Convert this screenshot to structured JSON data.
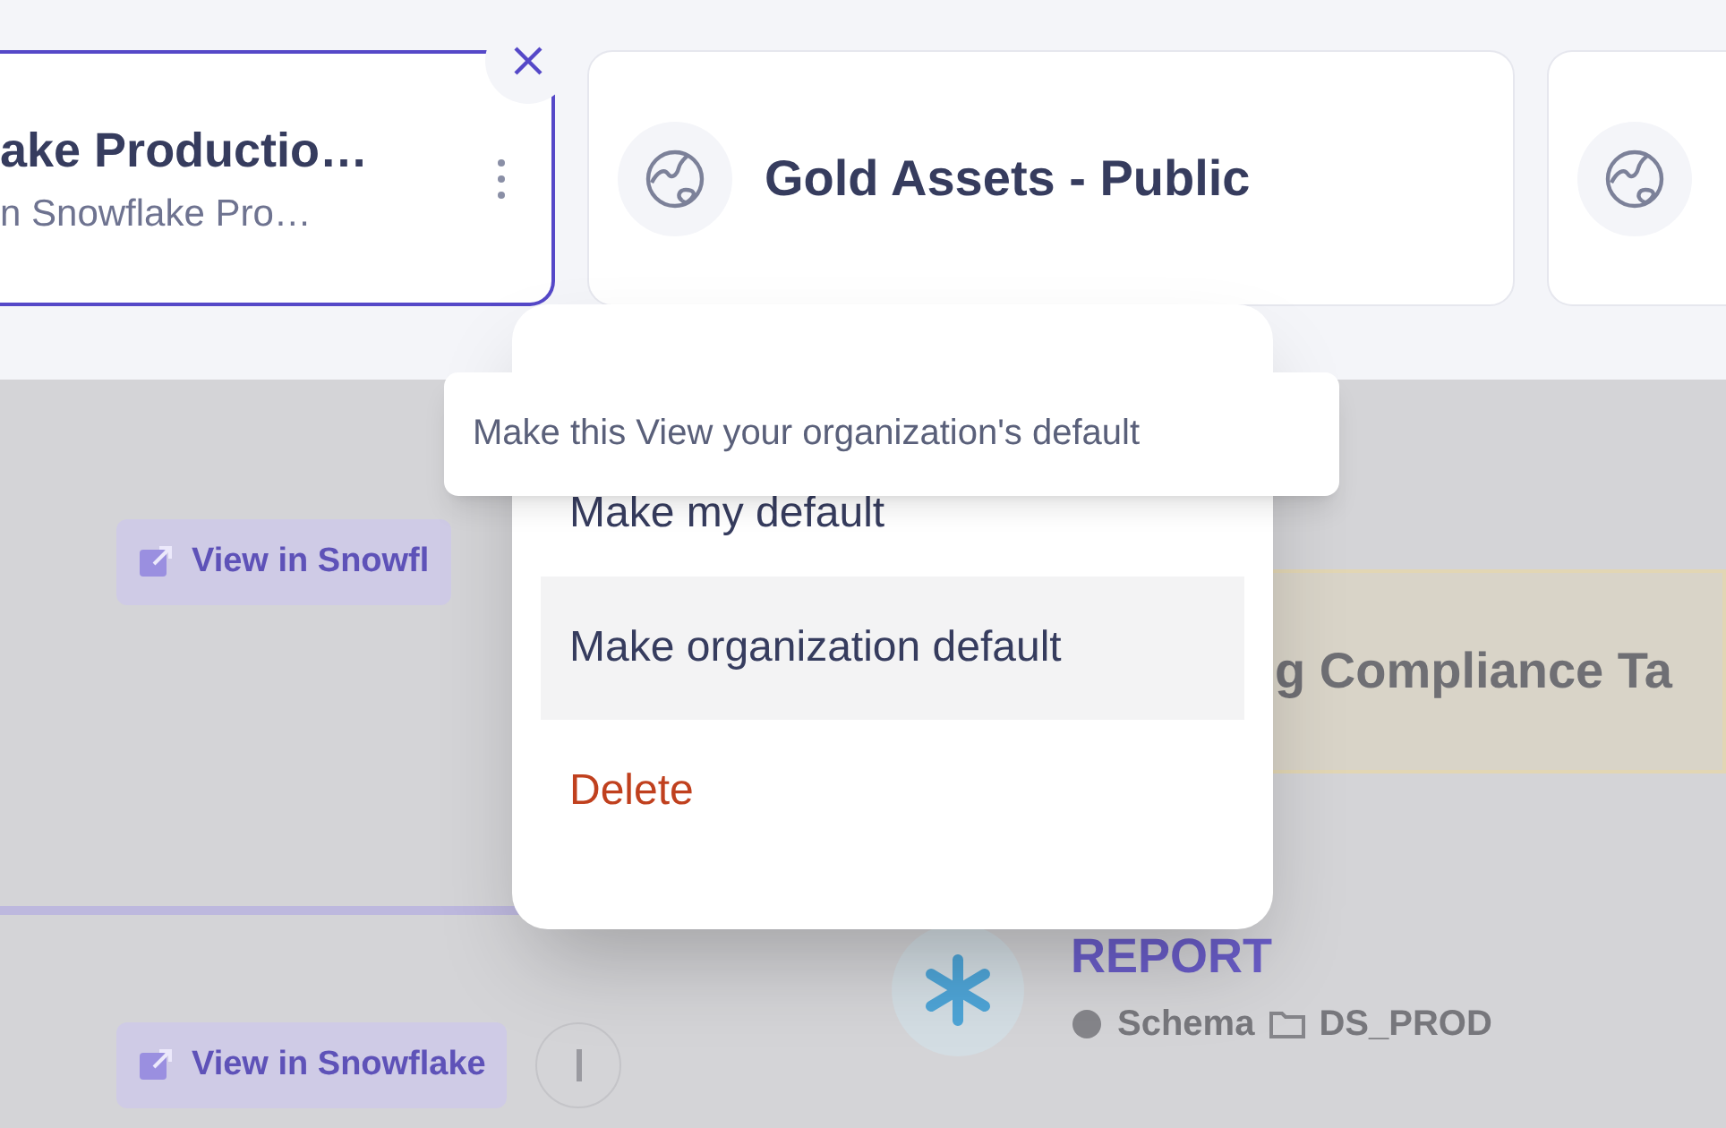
{
  "view_cards": [
    {
      "title": "ake Productio…",
      "subtitle": "n Snowflake Pro…",
      "selected": true
    },
    {
      "title": "Gold Assets - Public",
      "selected": false
    },
    {
      "selected": false
    }
  ],
  "menu": {
    "items": [
      {
        "label": "Make my default",
        "kind": "normal",
        "selected": false
      },
      {
        "label": "Make organization default",
        "kind": "normal",
        "selected": true
      },
      {
        "label": "Delete",
        "kind": "danger",
        "selected": false
      }
    ],
    "tooltip": "Make this View your organization's default"
  },
  "background": {
    "left_links": [
      "View in Snowfl",
      "View in Snowflake"
    ],
    "banner": "g Compliance Ta",
    "asset": {
      "name": "REPORT",
      "type": "Schema",
      "database": "DS_PROD"
    }
  }
}
